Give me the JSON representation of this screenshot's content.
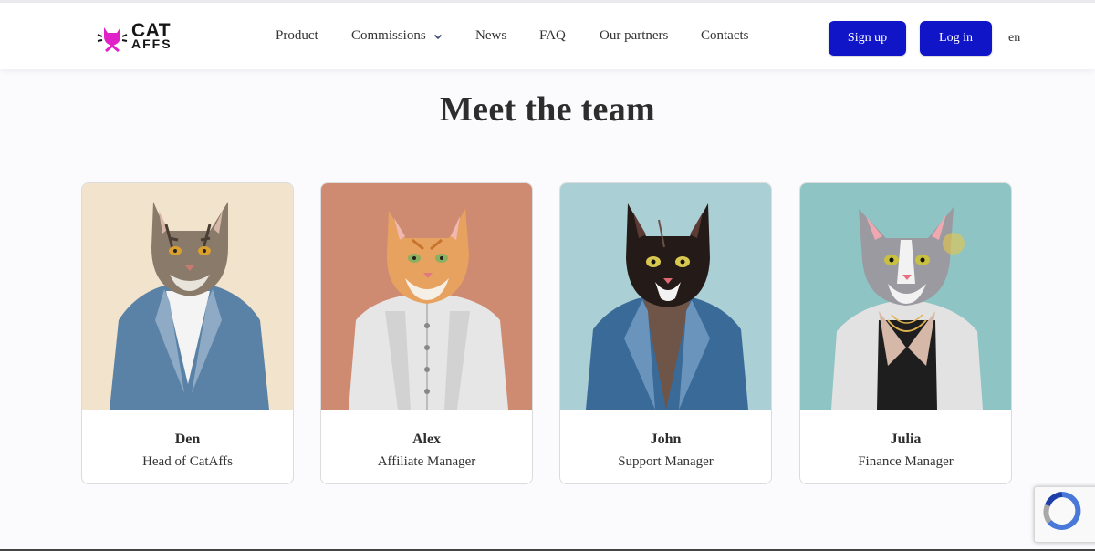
{
  "brand": {
    "line1": "CAT",
    "line2": "AFFS",
    "icon": "cat-logo-icon",
    "accent": "#e020c8"
  },
  "nav": {
    "items": [
      {
        "label": "Product"
      },
      {
        "label": "Commissions"
      },
      {
        "label": "News"
      },
      {
        "label": "FAQ"
      },
      {
        "label": "Our partners"
      },
      {
        "label": "Contacts"
      }
    ]
  },
  "auth": {
    "signup_label": "Sign up",
    "login_label": "Log in",
    "button_color": "#1016c8"
  },
  "lang": "en",
  "title": "Meet the team",
  "team": [
    {
      "name": "Den",
      "role": "Head of CatAffs",
      "bg": "#f2e3cc"
    },
    {
      "name": "Alex",
      "role": "Affiliate Manager",
      "bg": "#cf8b72"
    },
    {
      "name": "John",
      "role": "Support Manager",
      "bg": "#aacfd4"
    },
    {
      "name": "Julia",
      "role": "Finance Manager",
      "bg": "#8ec4c4"
    }
  ]
}
